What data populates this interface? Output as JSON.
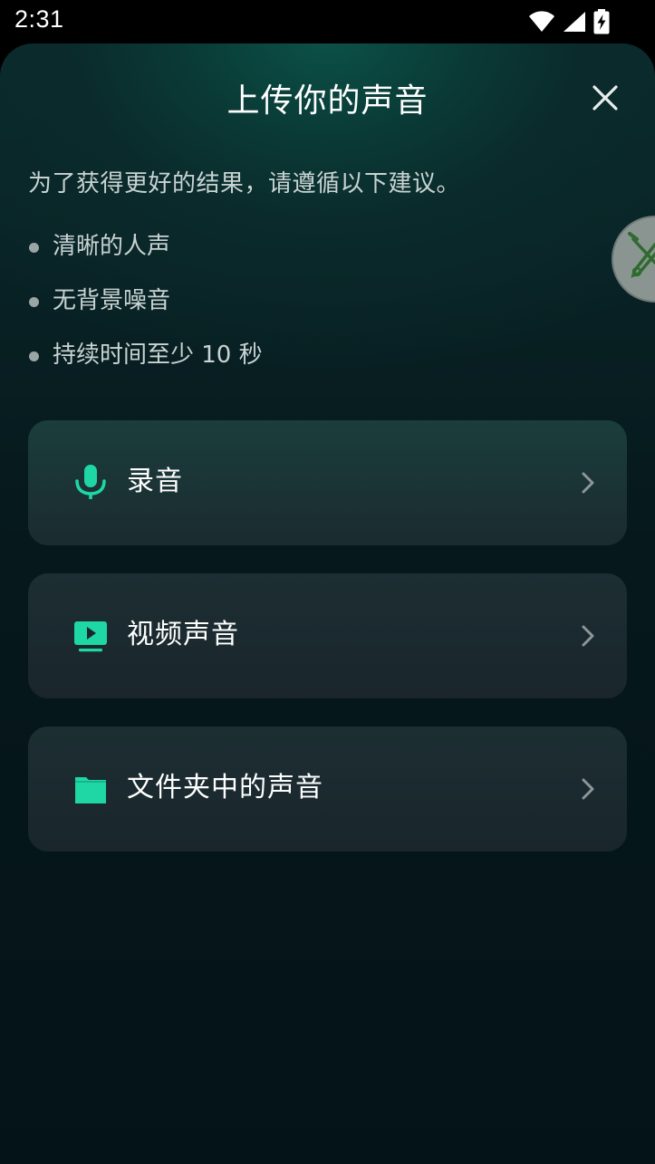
{
  "status_bar": {
    "time": "2:31",
    "icons": [
      "wifi-icon",
      "cell-signal-icon",
      "battery-charging-icon"
    ]
  },
  "sheet": {
    "title": "上传你的声音",
    "close_icon": "close-icon"
  },
  "intro": "为了获得更好的结果，请遵循以下建议。",
  "tips": [
    "清晰的人声",
    "无背景噪音",
    "持续时间至少 10 秒"
  ],
  "options": [
    {
      "label": "录音",
      "icon": "microphone-icon"
    },
    {
      "label": "视频声音",
      "icon": "video-icon"
    },
    {
      "label": "文件夹中的声音",
      "icon": "folder-icon"
    }
  ],
  "colors": {
    "accent": "#1ed7a4",
    "sheet_top": "#0b5248",
    "sheet_bottom": "#041318",
    "card": "#1b2b30",
    "text_primary": "#ffffff",
    "text_secondary": "#c9d3d2"
  }
}
